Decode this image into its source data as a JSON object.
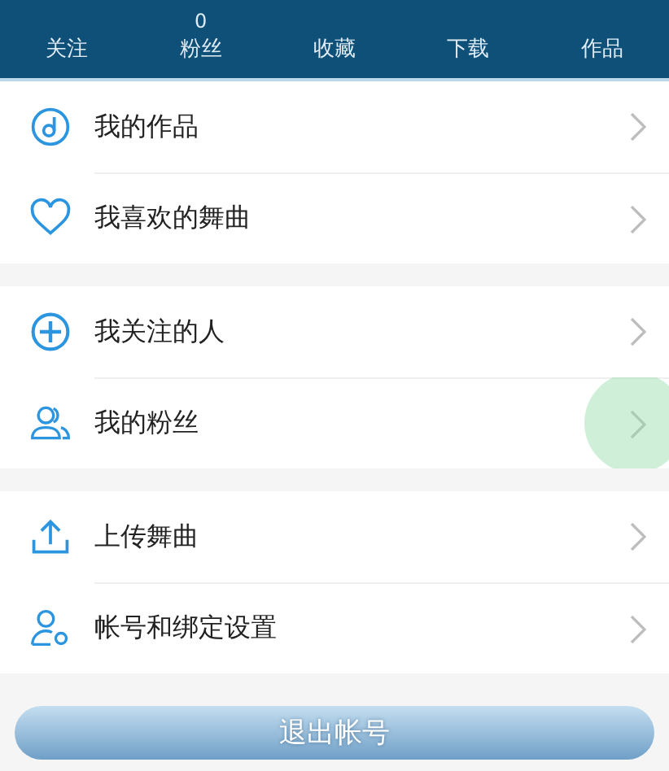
{
  "stats": [
    {
      "label": "关注"
    },
    {
      "label": "粉丝",
      "count": "0"
    },
    {
      "label": "收藏"
    },
    {
      "label": "下载"
    },
    {
      "label": "作品"
    }
  ],
  "groups": [
    [
      {
        "label": "我的作品",
        "kind": "music",
        "pressed": false
      },
      {
        "label": "我喜欢的舞曲",
        "kind": "heart",
        "pressed": false
      }
    ],
    [
      {
        "label": "我关注的人",
        "kind": "plus",
        "pressed": false
      },
      {
        "label": "我的粉丝",
        "kind": "users",
        "pressed": true
      }
    ],
    [
      {
        "label": "上传舞曲",
        "kind": "upload",
        "pressed": false
      },
      {
        "label": "帐号和绑定设置",
        "kind": "settings",
        "pressed": false
      }
    ]
  ],
  "logout_button": "退出帐号"
}
